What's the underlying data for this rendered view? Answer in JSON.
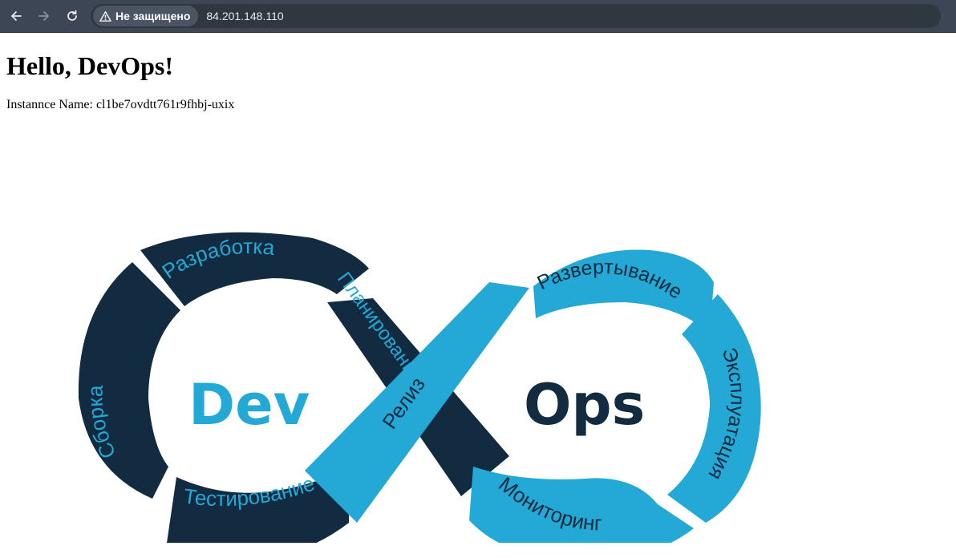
{
  "browser": {
    "security_label": "Не защищено",
    "url": "84.201.148.110"
  },
  "page": {
    "heading": "Hello, DevOps!",
    "instance_label": "Instannce Name: cl1be7ovdtt761r9fhbj-uxix"
  },
  "logo": {
    "dev": "Dev",
    "ops": "Ops",
    "stages": {
      "razrabotka": "Разработка",
      "sborka": "Сборка",
      "testirovanie": "Тестирование",
      "planirovanie": "Планирование",
      "reliz": "Релиз",
      "razvertyvanie": "Развертывание",
      "ekspluatatsiya": "Эксплуатация",
      "monitoring": "Мониторинг"
    },
    "colors": {
      "dark": "#132b40",
      "light": "#24a8d5"
    }
  }
}
